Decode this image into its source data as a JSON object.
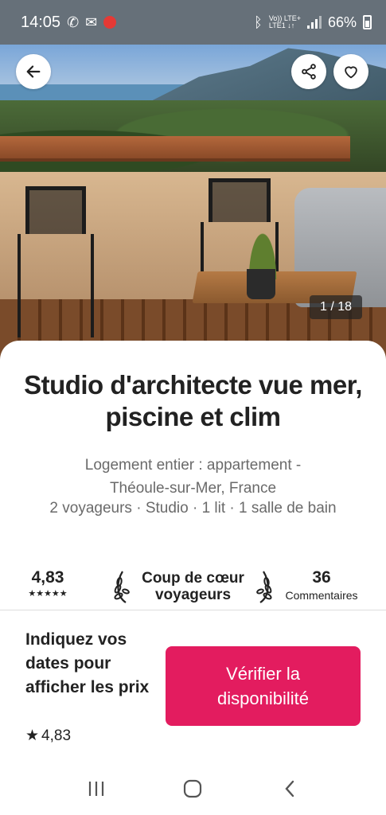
{
  "status_bar": {
    "time": "14:05",
    "network": [
      "Vo)) LTE+",
      "LTE1 ↓↑"
    ],
    "battery": "66%"
  },
  "listing": {
    "photo_counter": "1 / 18",
    "title": "Studio d'architecte vue mer, piscine et clim",
    "subtitle_line1": "Logement entier : appartement -",
    "subtitle_line2": "Théoule-sur-Mer, France",
    "details": "2 voyageurs · Studio · 1 lit · 1 salle de bain"
  },
  "stats": {
    "rating": "4,83",
    "stars": "★★★★★",
    "favorite_line1": "Coup de cœur",
    "favorite_line2": "voyageurs",
    "reviews_count": "36",
    "reviews_label": "Commentaires"
  },
  "footer": {
    "prompt": "Indiquez vos dates pour afficher les prix",
    "rating_star": "★",
    "rating": "4,83",
    "cta_label": "Vérifier la disponibilité"
  },
  "colors": {
    "accent": "#e31c5f",
    "status_bar_bg": "#667079"
  },
  "icons": [
    "back-arrow-icon",
    "share-icon",
    "heart-icon",
    "laurel-left-icon",
    "laurel-right-icon",
    "recent-apps-icon",
    "home-icon",
    "back-nav-icon"
  ]
}
